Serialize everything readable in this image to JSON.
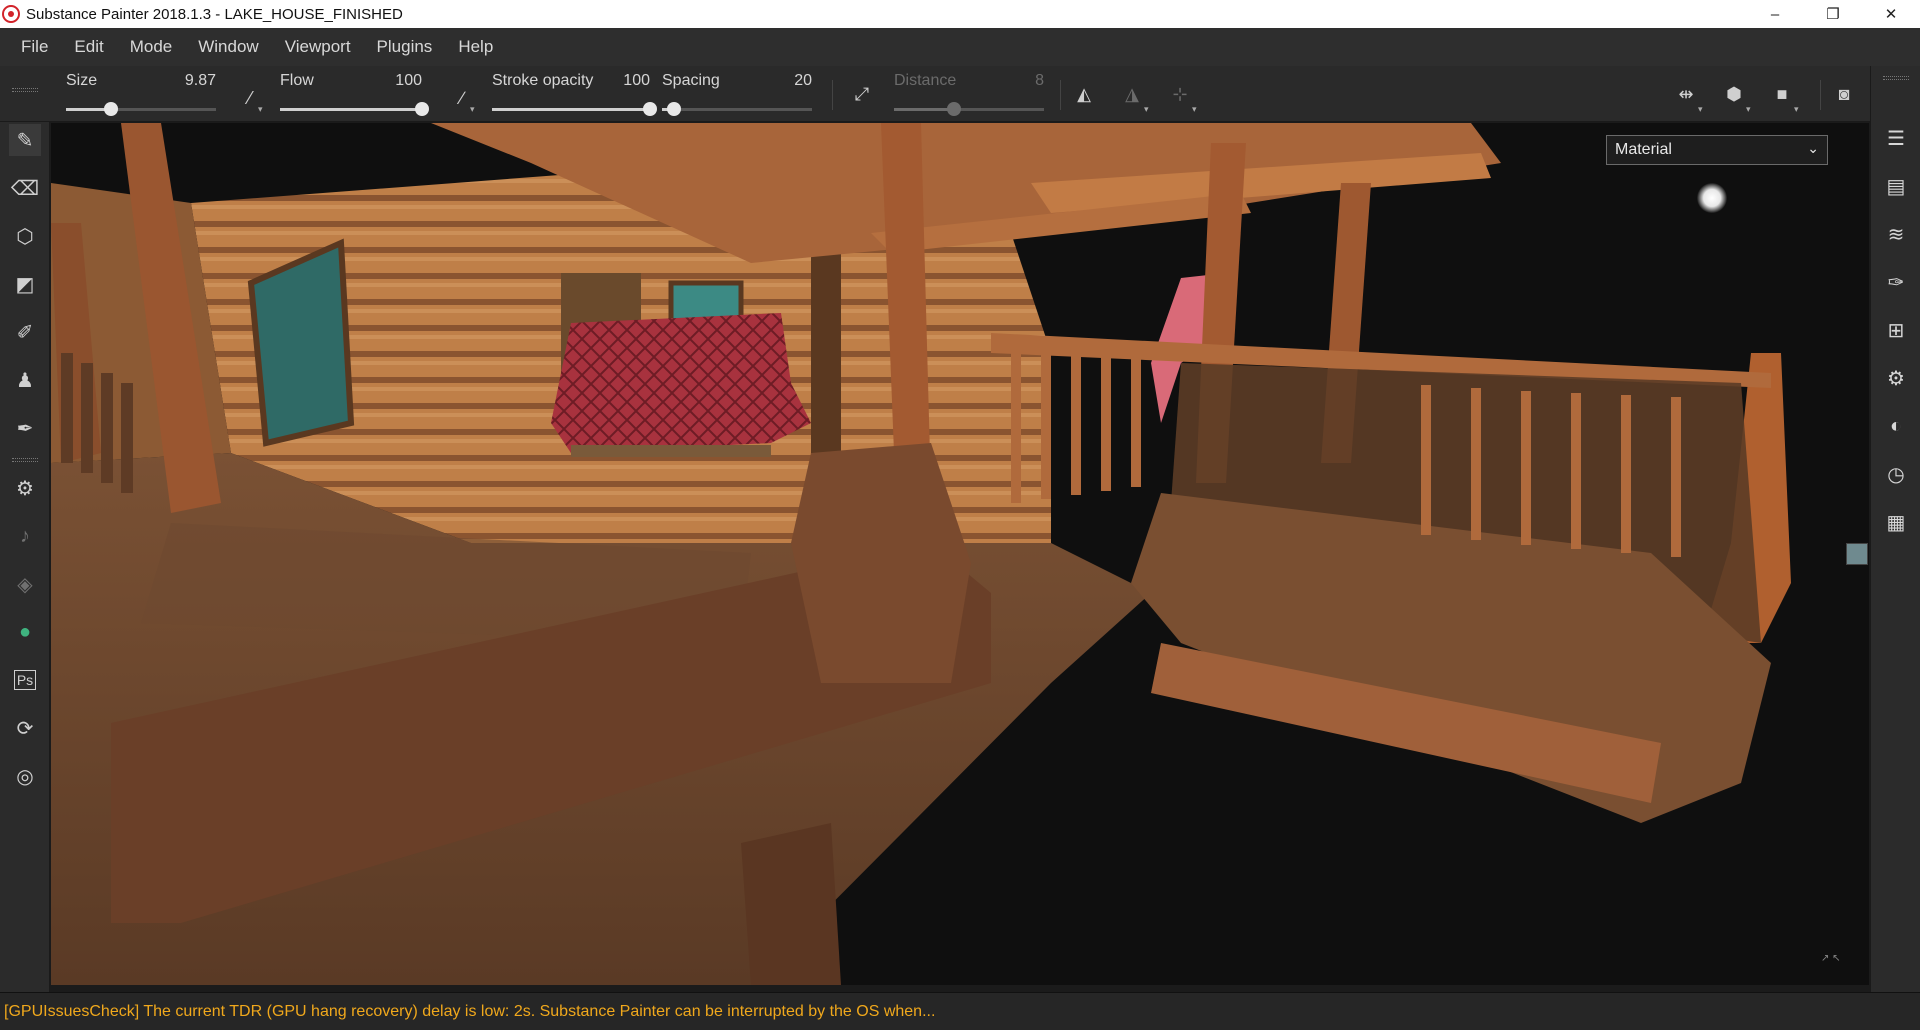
{
  "window": {
    "title": "Substance Painter 2018.1.3 - LAKE_HOUSE_FINISHED",
    "minimize_glyph": "–",
    "restore_glyph": "❐",
    "close_glyph": "✕"
  },
  "menu": [
    "File",
    "Edit",
    "Mode",
    "Window",
    "Viewport",
    "Plugins",
    "Help"
  ],
  "tool_properties": {
    "size": {
      "label": "Size",
      "value": "9.87",
      "level": 0.3
    },
    "flow": {
      "label": "Flow",
      "value": "100",
      "level": 1.0
    },
    "stroke_opacity": {
      "label": "Stroke opacity",
      "value": "100",
      "level": 1.0
    },
    "spacing": {
      "label": "Spacing",
      "value": "20",
      "level": 0.08
    },
    "distance": {
      "label": "Distance",
      "value": "8",
      "level": 0.4,
      "enabled": false
    }
  },
  "toolbar_icons": [
    "brush-shape-icon",
    "pen-pressure-icon",
    "lazy-mouse-icon",
    "symmetry-icon",
    "mirror-icon",
    "mirror-center-icon",
    "projection-icon",
    "camera-view-icon",
    "display-settings-icon",
    "screenshot-icon"
  ],
  "left_tools": [
    "paint-brush-icon",
    "eraser-icon",
    "projection-icon",
    "polygon-fill-icon",
    "smudge-icon",
    "clone-stamp-icon",
    "color-picker-icon",
    "substance-source-icon",
    "bell-icon",
    "substance-icon",
    "share-icon",
    "photoshop-icon",
    "bake-icon",
    "substance-share-icon"
  ],
  "left_labels": {
    "photoshop": "Ps"
  },
  "right_docks": [
    "layers-list-icon",
    "texture-set-list-icon",
    "layer-stack-icon",
    "properties-icon",
    "texture-set-settings-icon",
    "display-settings-icon",
    "shader-settings-icon",
    "history-icon",
    "log-icon"
  ],
  "viewport": {
    "channel_select": "Material",
    "channel_chevron": "⌄"
  },
  "status": {
    "message": "[GPUIssuesCheck] The current TDR (GPU hang recovery) delay is low: 2s. Substance Painter can be interrupted by the OS when..."
  },
  "colors": {
    "status_warning": "#f0a81c",
    "log_wood": "#a9643a",
    "couch_red": "#a8323e",
    "chair_pink": "#d96a78"
  }
}
